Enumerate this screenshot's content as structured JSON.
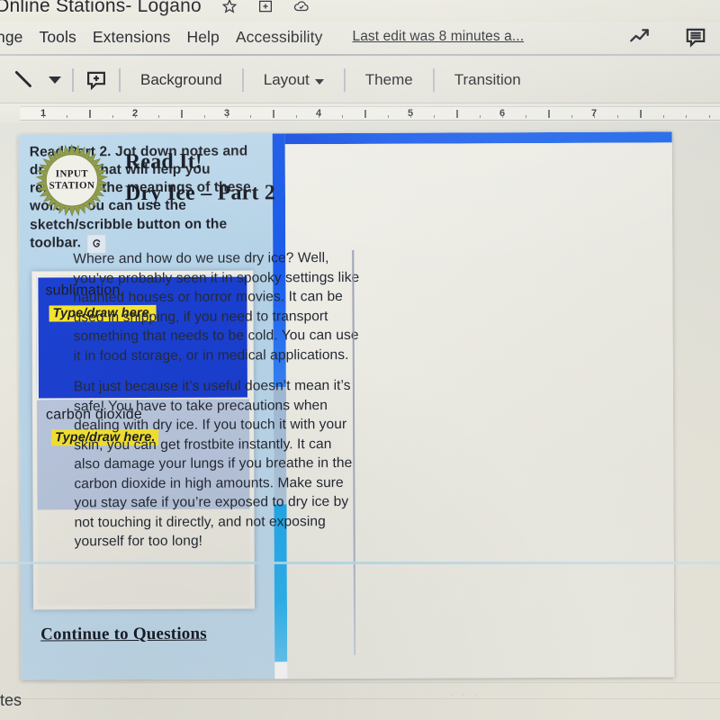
{
  "app": {
    "doc_title": "Online Stations- Logano",
    "title_icons": [
      "star-icon",
      "move-to-folder-icon",
      "cloud-saved-icon"
    ],
    "last_edit": "Last edit was 8 minutes a...",
    "right_icons": [
      "activity-chart-icon",
      "comment-icon"
    ]
  },
  "menu": {
    "items": [
      "nge",
      "Tools",
      "Extensions",
      "Help",
      "Accessibility"
    ]
  },
  "toolbar": {
    "line_tool": "line-tool-icon",
    "caret": "dropdown-caret-icon",
    "add_comment": "add-comment-icon",
    "background_label": "Background",
    "layout_label": "Layout",
    "theme_label": "Theme",
    "transition_label": "Transition"
  },
  "ruler": {
    "numbers": [
      "1",
      "2",
      "3",
      "4",
      "5",
      "6",
      "7"
    ]
  },
  "slide": {
    "left_pane": {
      "instructions": "Read Part 2. Jot down notes and drawings that will help you remember the meanings of these words. You can use the sketch/scribble button on the toolbar.",
      "scribble_icon": "scribble-icon",
      "word_boxes": [
        {
          "term": "sublimation",
          "placeholder": "Type/draw here.",
          "selected": true
        },
        {
          "term": "carbon dioxide",
          "placeholder": "Type/draw here.",
          "selected": false
        },
        {
          "term": "",
          "placeholder": "",
          "selected": false
        }
      ],
      "continue_link": "Continue to Questions"
    },
    "right_pane": {
      "badge_line1": "INPUT",
      "badge_line2": "STATION",
      "heading_line1": "Read It!",
      "heading_line2": "Dry Ice – Part 2",
      "paragraphs": [
        "Where and how do we use dry ice? Well, you’ve probably seen it in spooky settings like haunted houses or horror movies. It can be used in shipping, if you need to transport something that needs to be cold. You can use it in food storage, or in medical applications.",
        "But just because it’s useful doesn’t mean it’s safe! You have to take precautions when dealing with dry ice. If you touch it with your skin, you can get frostbite instantly. It can also damage your lungs if you breathe in the carbon dioxide in high amounts. Make sure you stay safe if you’re exposed to dry ice by not touching it directly, and not exposing yourself for too long!"
      ]
    }
  },
  "notes": {
    "label": "otes"
  },
  "colors": {
    "accent_blue": "#1238cf",
    "strip_deep_blue": "#0b4fe8",
    "strip_cyan": "#1fa8ee",
    "highlight_yellow": "#f5e32a",
    "left_pane_blue": "#b3d2e8"
  }
}
